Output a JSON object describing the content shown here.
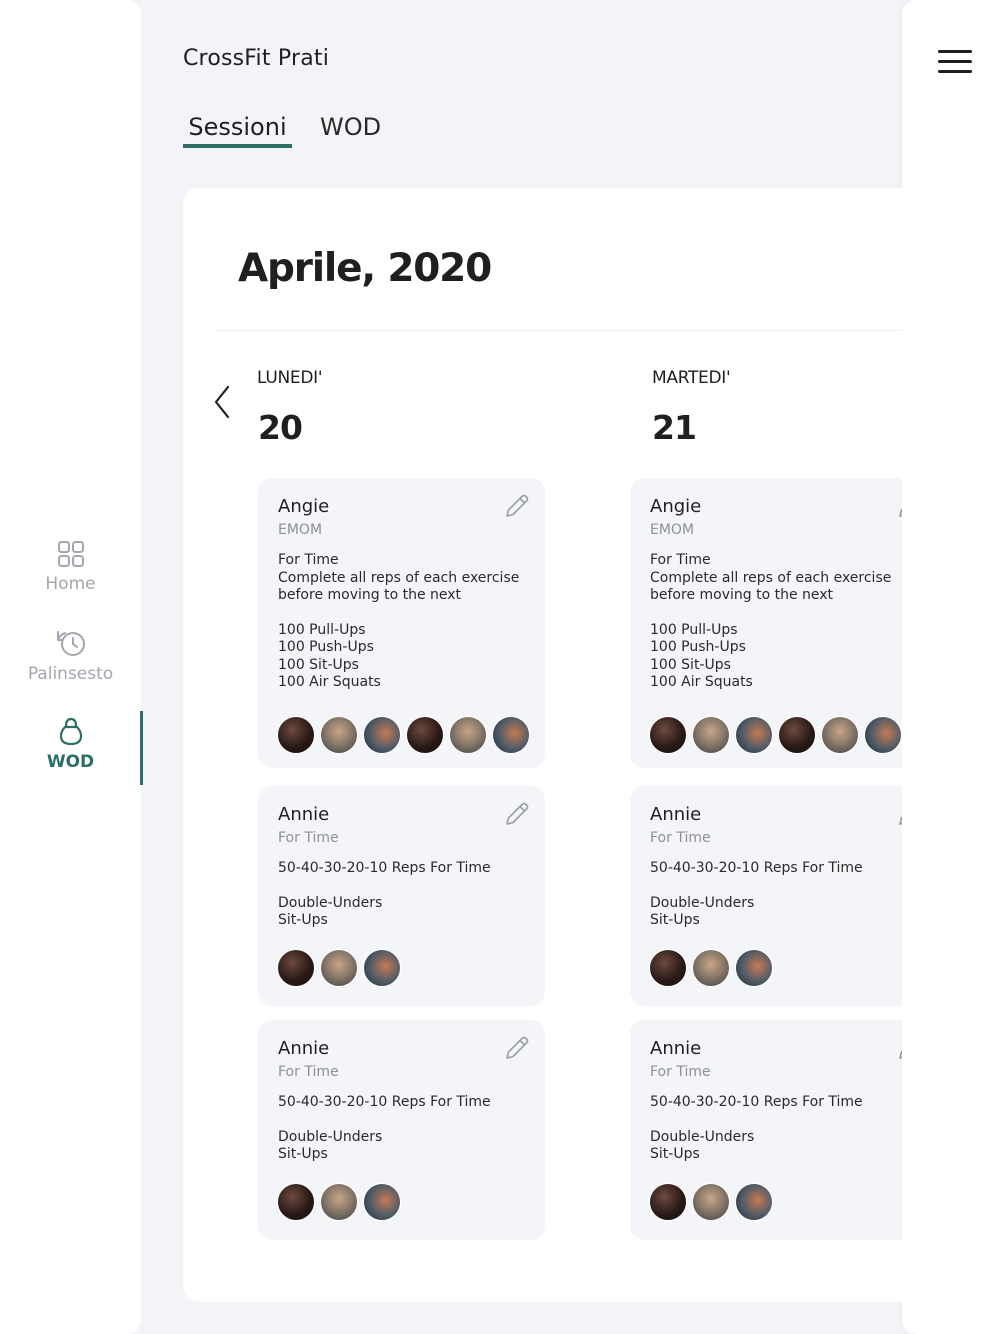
{
  "app": {
    "title": "CrossFit Prati"
  },
  "tabs": [
    {
      "label": "Sessioni",
      "active": true
    },
    {
      "label": "WOD",
      "active": false
    }
  ],
  "nav": {
    "items": [
      {
        "label": "Home",
        "icon": "grid-icon",
        "active": false
      },
      {
        "label": "Palinsesto",
        "icon": "history-clock-icon",
        "active": false
      },
      {
        "label": "WOD",
        "icon": "kettlebell-icon",
        "active": true
      }
    ]
  },
  "colors": {
    "accent": "#2c6f66",
    "inactive": "#a3a7ad",
    "card_bg": "#f4f5f8"
  },
  "calendar": {
    "month": "Aprile, 2020",
    "days": [
      {
        "name": "LUNEDI'",
        "number": "20",
        "cards": [
          {
            "title": "Angie",
            "type": "EMOM",
            "lines": [
              "For Time",
              "Complete all reps of each exercise",
              "before moving to the next"
            ],
            "exercises": [
              "100 Pull-Ups",
              "100 Push-Ups",
              "100 Sit-Ups",
              "100 Air Squats"
            ],
            "participants": 6
          },
          {
            "title": "Annie",
            "type": "For Time",
            "lines": [
              "50-40-30-20-10 Reps For Time"
            ],
            "exercises": [
              "Double-Unders",
              "Sit-Ups"
            ],
            "participants": 3
          },
          {
            "title": "Annie",
            "type": "For Time",
            "lines": [
              "50-40-30-20-10 Reps For Time"
            ],
            "exercises": [
              "Double-Unders",
              "Sit-Ups"
            ],
            "participants": 3
          }
        ]
      },
      {
        "name": "MARTEDI'",
        "number": "21",
        "cards": [
          {
            "title": "Angie",
            "type": "EMOM",
            "lines": [
              "For Time",
              "Complete all reps of each exercise",
              "before moving to the next"
            ],
            "exercises": [
              "100 Pull-Ups",
              "100 Push-Ups",
              "100 Sit-Ups",
              "100 Air Squats"
            ],
            "participants": 6
          },
          {
            "title": "Annie",
            "type": "For Time",
            "lines": [
              "50-40-30-20-10 Reps For Time"
            ],
            "exercises": [
              "Double-Unders",
              "Sit-Ups"
            ],
            "participants": 3
          },
          {
            "title": "Annie",
            "type": "For Time",
            "lines": [
              "50-40-30-20-10 Reps For Time"
            ],
            "exercises": [
              "Double-Unders",
              "Sit-Ups"
            ],
            "participants": 3
          }
        ]
      }
    ]
  }
}
